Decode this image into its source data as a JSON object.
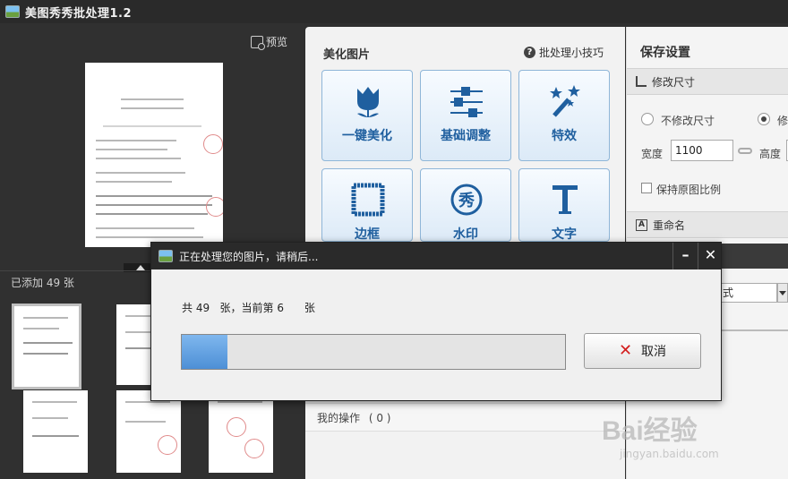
{
  "window": {
    "title": "美图秀秀批处理1.2"
  },
  "left_panel": {
    "preview_label": "预览",
    "added_count_label": "已添加 49 张"
  },
  "middle_panel": {
    "heading": "美化图片",
    "tips_label": "批处理小技巧",
    "tiles": [
      {
        "label": "一键美化",
        "icon": "tulip-icon"
      },
      {
        "label": "基础调整",
        "icon": "sliders-icon"
      },
      {
        "label": "特效",
        "icon": "magic-wand-icon"
      },
      {
        "label": "边框",
        "icon": "frame-icon"
      },
      {
        "label": "水印",
        "icon": "xiu-stamp-icon"
      },
      {
        "label": "文字",
        "icon": "text-t-icon"
      }
    ],
    "my_operations_label": "我的操作",
    "my_operations_count": "( 0 )"
  },
  "right_panel": {
    "title": "保存设置",
    "resize_section": "修改尺寸",
    "no_resize_option": "不修改尺寸",
    "resize_option_partial": "修",
    "width_label": "宽度",
    "width_value": "1100",
    "height_label": "高度",
    "keep_ratio_label": "保持原图比例",
    "rename_section": "重命名",
    "format_partial": "式"
  },
  "dialog": {
    "title": "正在处理您的图片，请稍后...",
    "status_text": "共 49   张，当前第 6      张",
    "progress": 0.12,
    "cancel_label": "取消",
    "minimize_glyph": "–",
    "close_glyph": "✕"
  },
  "watermark": {
    "main": "Bai经验",
    "sub": "jingyan.baidu.com"
  },
  "colors": {
    "accent": "#1f5f9f",
    "progress": "#4d8fd6",
    "cancel_x": "#d31e1e"
  }
}
